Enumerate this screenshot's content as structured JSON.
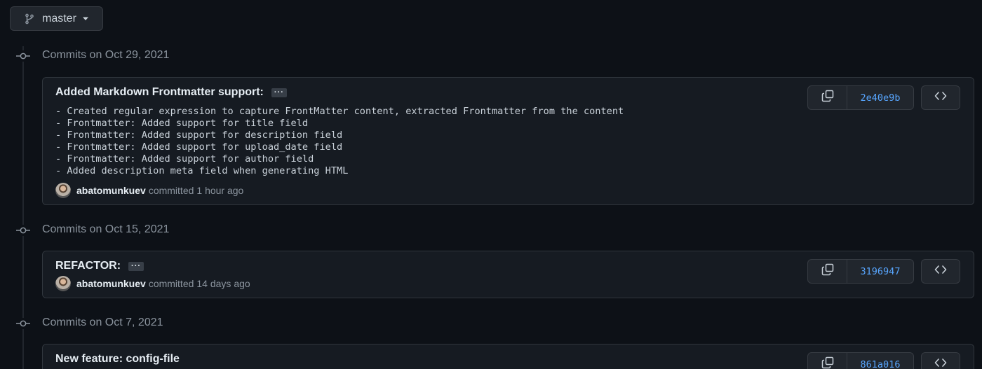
{
  "branch": {
    "name": "master",
    "icon": "git-branch-icon"
  },
  "groups": [
    {
      "title": "Commits on Oct 29, 2021",
      "commit": {
        "title": "Added Markdown Frontmatter support:",
        "ellipsis": "···",
        "body": "- Created regular expression to capture FrontMatter content, extracted Frontmatter from the content\n- Frontmatter: Added support for title field\n- Frontmatter: Added support for description field\n- Frontmatter: Added support for upload_date field\n- Frontmatter: Added support for author field\n- Added description meta field when generating HTML",
        "author": "abatomunkuev",
        "action": "committed",
        "time": "1 hour ago",
        "sha": "2e40e9b"
      }
    },
    {
      "title": "Commits on Oct 15, 2021",
      "commit": {
        "title": "REFACTOR:",
        "ellipsis": "···",
        "author": "abatomunkuev",
        "action": "committed",
        "time": "14 days ago",
        "sha": "3196947"
      }
    },
    {
      "title": "Commits on Oct 7, 2021",
      "commit": {
        "title": "New feature: config-file",
        "sha": "861a016"
      }
    }
  ],
  "colors": {
    "background": "#0d1117",
    "box": "#161b22",
    "border": "#30363d",
    "link": "#58a6ff",
    "muted": "#8b949e"
  }
}
